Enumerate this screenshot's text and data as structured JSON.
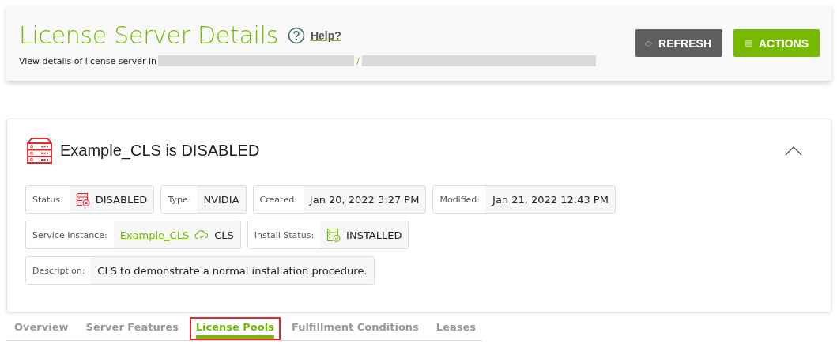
{
  "header": {
    "title": "License Server Details",
    "help": "Help?",
    "subtitle": "View details of license server in",
    "separator": "/",
    "buttons": [
      {
        "kind": "refresh",
        "label": "REFRESH"
      },
      {
        "kind": "actions",
        "label": "ACTIONS"
      }
    ]
  },
  "server": {
    "title": "Example_CLS is DISABLED",
    "error": true,
    "expanded": true,
    "lines": [
      {
        "fields": [
          {
            "label": "Status:",
            "kind": "status",
            "error": true,
            "value": "DISABLED"
          },
          {
            "label": "Type:",
            "kind": "text",
            "value": "NVIDIA"
          },
          {
            "label": "Created:",
            "kind": "text",
            "value": "Jan 20, 2022 3:27 PM"
          },
          {
            "label": "Modified:",
            "kind": "text",
            "value": "Jan 21, 2022 12:43 PM"
          }
        ]
      },
      {
        "fields": [
          {
            "label": "Service Instance:",
            "kind": "link",
            "link": "Example_CLS",
            "value": "CLS"
          },
          {
            "label": "Install Status:",
            "kind": "status",
            "error": false,
            "value": "INSTALLED"
          }
        ]
      },
      {
        "fields": [
          {
            "label": "Description:",
            "kind": "text",
            "value": "CLS to demonstrate a normal installation procedure."
          }
        ]
      }
    ]
  },
  "tabs": [
    {
      "label": "Overview",
      "selected": false,
      "highlighted": false
    },
    {
      "label": "Server Features",
      "selected": false,
      "highlighted": false
    },
    {
      "label": "License Pools",
      "selected": true,
      "highlighted": true
    },
    {
      "label": "Fulfillment Conditions",
      "selected": false,
      "highlighted": false
    },
    {
      "label": "Leases",
      "selected": false,
      "highlighted": false
    }
  ]
}
